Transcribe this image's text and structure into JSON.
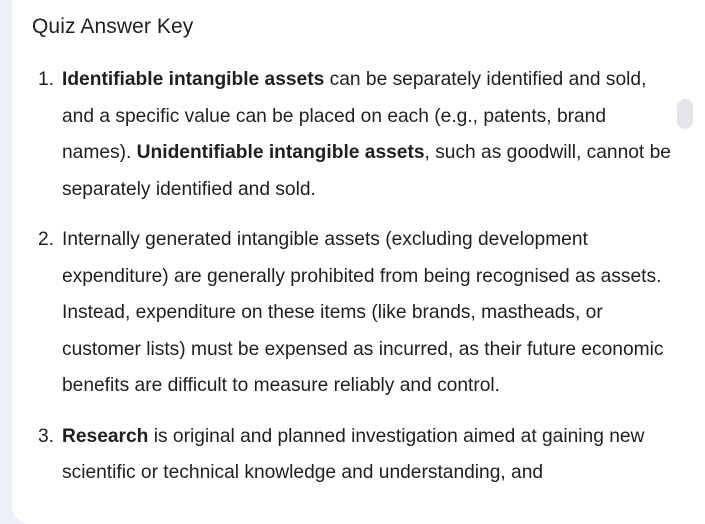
{
  "title": "Quiz Answer Key",
  "answers": [
    {
      "number": "1.",
      "bold1": "Identifiable intangible assets",
      "text1": " can be separately identified and sold, and a specific value can be placed on each (e.g., patents, brand names). ",
      "bold2": "Unidentifiable intangible assets",
      "text2": ", such as goodwill, cannot be separately identified and sold."
    },
    {
      "number": "2.",
      "text": "Internally generated intangible assets (excluding development expenditure) are generally prohibited from being recognised as assets. Instead, expenditure on these items (like brands, mastheads, or customer lists) must be expensed as incurred, as their future economic benefits are difficult to measure reliably and control."
    },
    {
      "number": "3.",
      "bold": "Research",
      "text": " is original and planned investigation aimed at gaining new scientific or technical knowledge and understanding, and"
    }
  ]
}
